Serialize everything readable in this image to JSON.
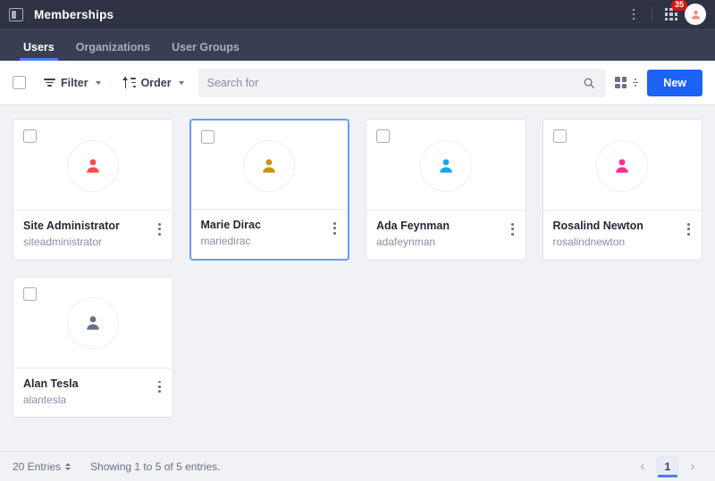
{
  "header": {
    "panel_toggle_icon": "panel-toggle-icon",
    "title": "Memberships",
    "menu_icon": "vertical-dots-icon",
    "apps_icon": "apps-grid-icon",
    "notification_count": "35",
    "avatar_icon": "user-avatar-icon"
  },
  "tabs": [
    {
      "label": "Users",
      "active": true
    },
    {
      "label": "Organizations",
      "active": false
    },
    {
      "label": "User Groups",
      "active": false
    }
  ],
  "toolbar": {
    "select_all_checkbox": "select-all",
    "filter_label": "Filter",
    "order_label": "Order",
    "search_placeholder": "Search for",
    "search_value": "",
    "search_icon": "search-icon",
    "view_grid_icon": "grid-view-icon",
    "view_options_icon": "view-options-icon",
    "new_label": "New"
  },
  "cards": [
    {
      "name": "Site Administrator",
      "username": "siteadministrator",
      "avatar_color": "#ff4a4a",
      "selected": false
    },
    {
      "name": "Marie Dirac",
      "username": "mariedirac",
      "avatar_color": "#c9950a",
      "selected": true
    },
    {
      "name": "Ada Feynman",
      "username": "adafeynman",
      "avatar_color": "#17a7f0",
      "selected": false
    },
    {
      "name": "Rosalind Newton",
      "username": "rosalindnewton",
      "avatar_color": "#ff2d96",
      "selected": false
    },
    {
      "name": "Alan Tesla",
      "username": "alantesla",
      "avatar_color": "#6b7087",
      "selected": false
    }
  ],
  "footer": {
    "entries_label": "20 Entries",
    "showing_text": "Showing 1 to 5 of 5 entries.",
    "prev_label": "‹",
    "page_label": "1",
    "next_label": "›"
  },
  "colors": {
    "header_bg": "#2e3243",
    "tabbar_bg": "#393e52",
    "accent_blue": "#1c62f5",
    "tab_underline": "#4a7cf6",
    "badge_red": "#da1414",
    "page_bg": "#f0f2f5"
  }
}
